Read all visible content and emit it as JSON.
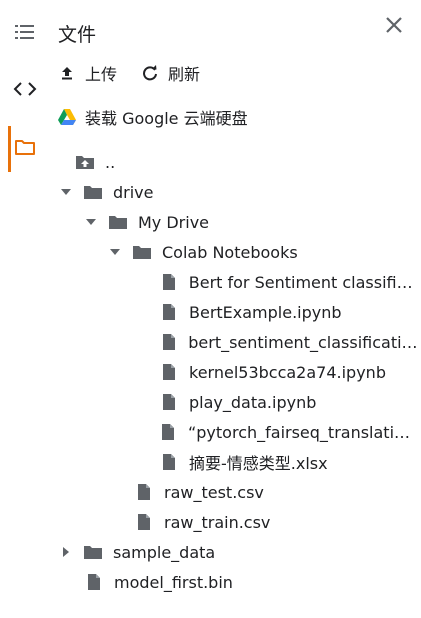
{
  "panel": {
    "title": "文件",
    "actions": {
      "upload_label": "上传",
      "refresh_label": "刷新",
      "mount_drive_label": "装载 Google 云端硬盘"
    },
    "accent_color": "#e8710a"
  },
  "rail": {
    "items": [
      "table-of-contents-icon",
      "code-icon",
      "folder-icon"
    ]
  },
  "tree": [
    {
      "label": "..",
      "icon": "folder-up-icon"
    },
    {
      "label": "drive",
      "icon": "folder-icon",
      "expanded": true
    },
    {
      "label": "My Drive",
      "icon": "folder-icon",
      "expanded": true
    },
    {
      "label": "Colab Notebooks",
      "icon": "folder-icon",
      "expanded": true
    },
    {
      "label": "Bert for Sentiment classific...",
      "icon": "file-icon"
    },
    {
      "label": "BertExample.ipynb",
      "icon": "file-icon"
    },
    {
      "label": "bert_sentiment_classificatio...",
      "icon": "file-icon"
    },
    {
      "label": "kernel53bcca2a74.ipynb",
      "icon": "file-icon"
    },
    {
      "label": "play_data.ipynb",
      "icon": "file-icon"
    },
    {
      "label": "“pytorch_fairseq_translation...",
      "icon": "file-icon"
    },
    {
      "label": "摘要-情感类型.xlsx",
      "icon": "file-icon"
    },
    {
      "label": "raw_test.csv",
      "icon": "file-icon"
    },
    {
      "label": "raw_train.csv",
      "icon": "file-icon"
    },
    {
      "label": "sample_data",
      "icon": "folder-icon",
      "expanded": false
    },
    {
      "label": "model_first.bin",
      "icon": "file-icon"
    }
  ]
}
